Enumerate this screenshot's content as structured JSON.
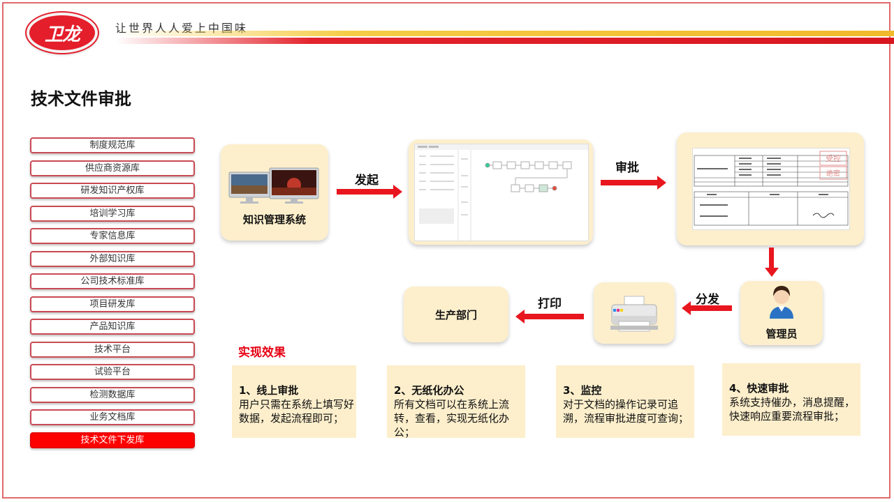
{
  "header": {
    "logo_text": "卫龙",
    "slogan": "让世界人人爱上中国味"
  },
  "page_title": "技术文件审批",
  "sidebar": {
    "items": [
      {
        "label": "制度规范库",
        "active": false
      },
      {
        "label": "供应商资源库",
        "active": false
      },
      {
        "label": "研发知识产权库",
        "active": false
      },
      {
        "label": "培训学习库",
        "active": false
      },
      {
        "label": "专家信息库",
        "active": false
      },
      {
        "label": "外部知识库",
        "active": false
      },
      {
        "label": "公司技术标准库",
        "active": false
      },
      {
        "label": "项目研发库",
        "active": false
      },
      {
        "label": "产品知识库",
        "active": false
      },
      {
        "label": "技术平台",
        "active": false
      },
      {
        "label": "试验平台",
        "active": false
      },
      {
        "label": "检测数据库",
        "active": false
      },
      {
        "label": "业务文档库",
        "active": false
      },
      {
        "label": "技术文件下发库",
        "active": true
      }
    ]
  },
  "flow": {
    "kms_label": "知识管理系统",
    "arrow_initiate": "发起",
    "arrow_approve": "审批",
    "admin_label": "管理员",
    "arrow_distribute": "分发",
    "arrow_print": "打印",
    "production_label": "生产部门",
    "doc_stamp_1": "受控",
    "doc_stamp_2": "绝密"
  },
  "effects": {
    "title": "实现效果",
    "items": [
      {
        "title": "1、线上审批",
        "body": "用户只需在系统上填写好数据，发起流程即可；"
      },
      {
        "title": "2、无纸化办公",
        "body": "所有文档可以在系统上流转，查看，实现无纸化办公；"
      },
      {
        "title": "3、监控",
        "body": "对于文档的操作记录可追溯，流程审批进度可查询；"
      },
      {
        "title": "4、快速审批",
        "body": "系统支持催办，消息提醒，快速响应重要流程审批；"
      }
    ]
  },
  "colors": {
    "accent_red": "#e8161e",
    "card_bg": "#fdefcc",
    "active_item": "#ff0000"
  }
}
